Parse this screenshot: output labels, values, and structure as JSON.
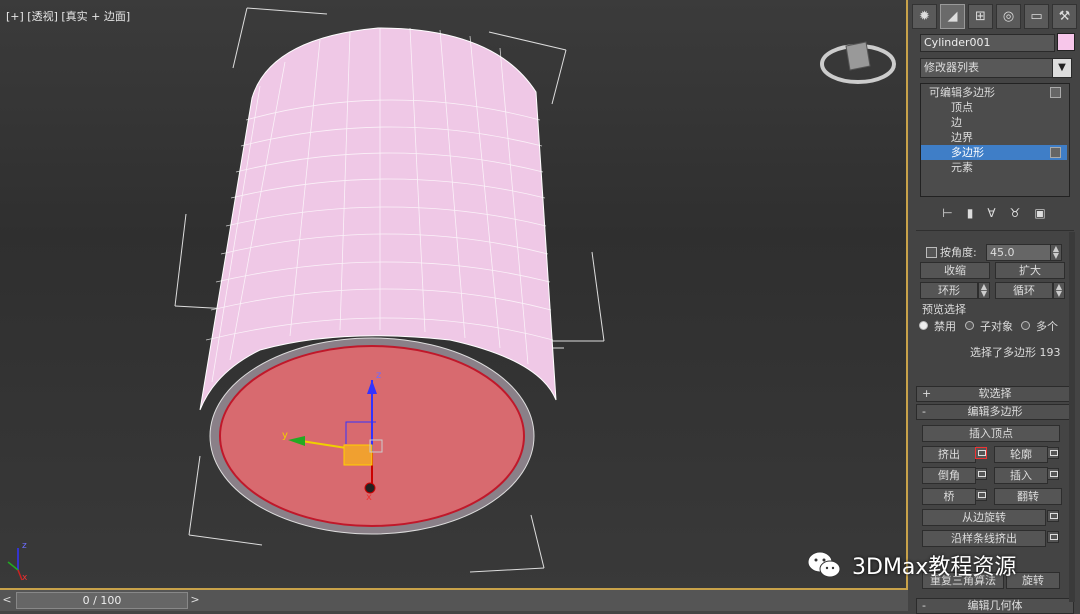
{
  "viewport": {
    "label": "[+] [透视] [真实 + 边面]",
    "axis_small": {
      "z": "z",
      "x": "x"
    },
    "gizmo": {
      "x": "x",
      "y": "y",
      "z": "z"
    }
  },
  "timeline": {
    "frame": "0 / 100",
    "prev": "<",
    "next": ">"
  },
  "panel": {
    "object_name": "Cylinder001",
    "object_color": "#f7c6ea",
    "modifier_list": "修改器列表",
    "stack": {
      "root": "可编辑多边形",
      "items": [
        "顶点",
        "边",
        "边界",
        "多边形",
        "元素"
      ],
      "selected": "多边形"
    },
    "selection": {
      "by_angle": "按角度:",
      "angle_value": "45.0",
      "shrink": "收缩",
      "grow": "扩大",
      "ring": "环形",
      "loop": "循环",
      "preview_title": "预览选择",
      "preview_options": [
        "禁用",
        "子对象",
        "多个"
      ],
      "status": "选择了多边形 193"
    },
    "soft_select": {
      "sign": "+",
      "title": "软选择"
    },
    "edit_poly": {
      "sign": "-",
      "title": "编辑多边形",
      "insert_vertex": "插入顶点",
      "extrude": "挤出",
      "outline": "轮廓",
      "bevel": "倒角",
      "inset": "插入",
      "bridge": "桥",
      "flip": "翻转",
      "hinge": "从边旋转",
      "extrude_spline": "沿样条线挤出",
      "retriangulate": "重复三角算法",
      "turn": "旋转"
    },
    "edit_geometry": {
      "sign": "-",
      "title": "编辑几何体"
    }
  },
  "watermark": "3DMax教程资源"
}
